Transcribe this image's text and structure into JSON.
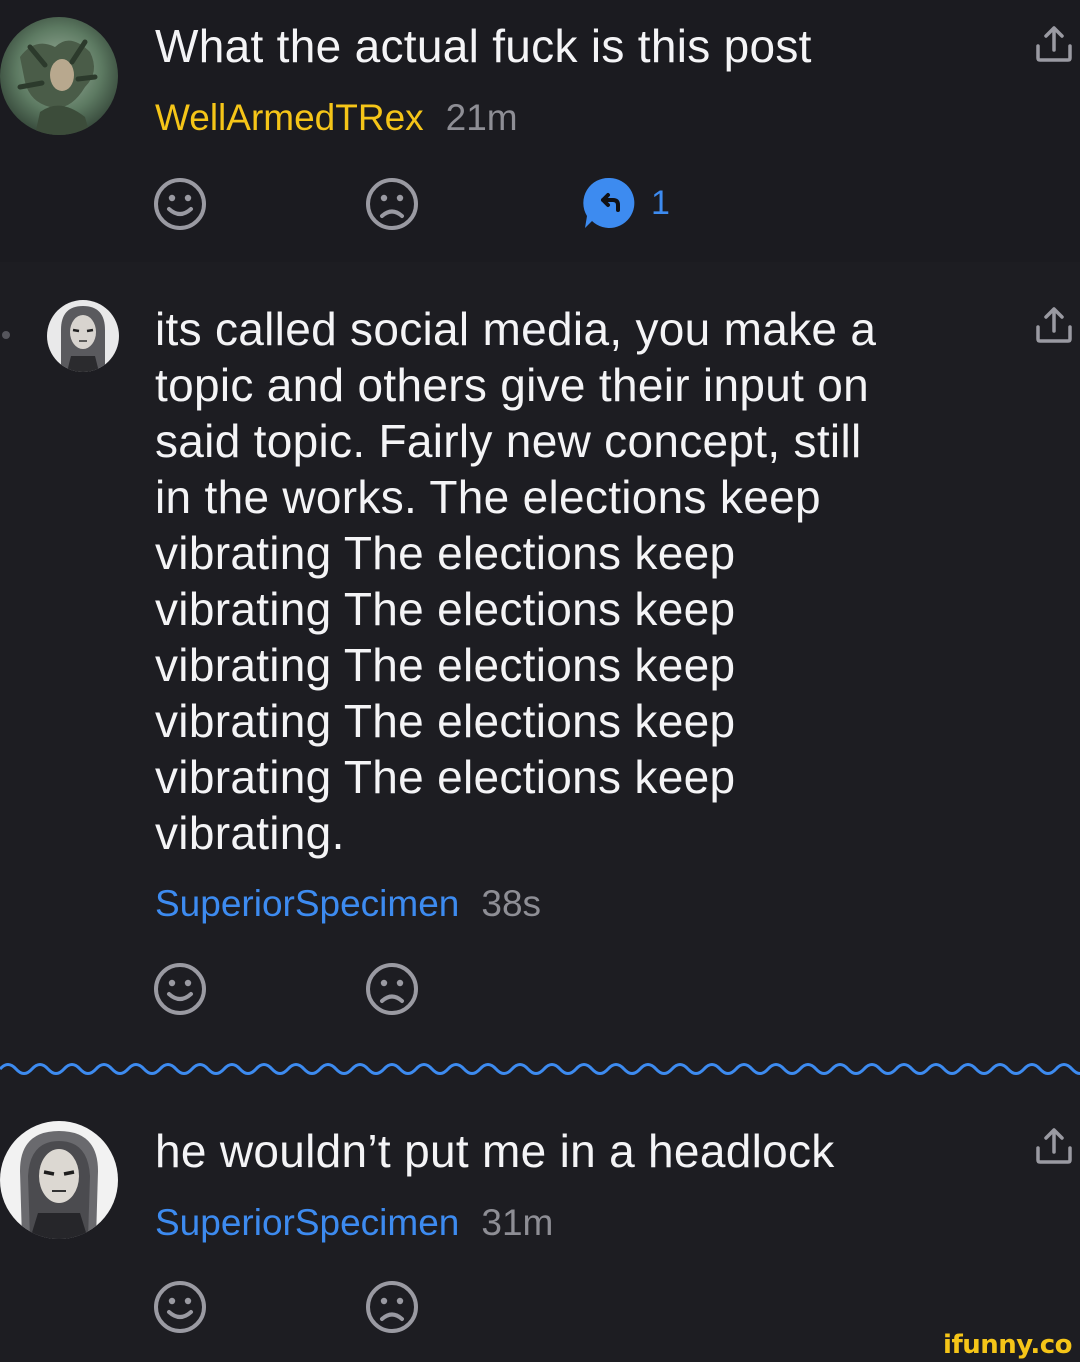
{
  "post": {
    "title": "What the actual fuck is this post",
    "author": "WellArmedTRex",
    "time": "21m",
    "reply_count": "1"
  },
  "reply": {
    "text": "its called social media, you make a\ntopic and others give their input on\nsaid topic. Fairly new concept, still\nin the works. The elections keep\nvibrating The elections keep\nvibrating The elections keep\nvibrating The elections keep\nvibrating The elections keep\nvibrating The elections keep\nvibrating.",
    "author": "SuperiorSpecimen",
    "time": "38s"
  },
  "comment": {
    "text": "he wouldn’t put me in a headlock",
    "author": "SuperiorSpecimen",
    "time": "31m"
  },
  "watermark": "ifunny.co",
  "icons": {
    "share": "share-icon",
    "smile": "smile-icon",
    "frown": "frown-icon",
    "reply": "reply-bubble-icon"
  },
  "colors": {
    "author_yellow": "#f5c518",
    "author_blue": "#3d8bf0",
    "time_gray": "#8e8e95",
    "background": "#1d1d22"
  }
}
